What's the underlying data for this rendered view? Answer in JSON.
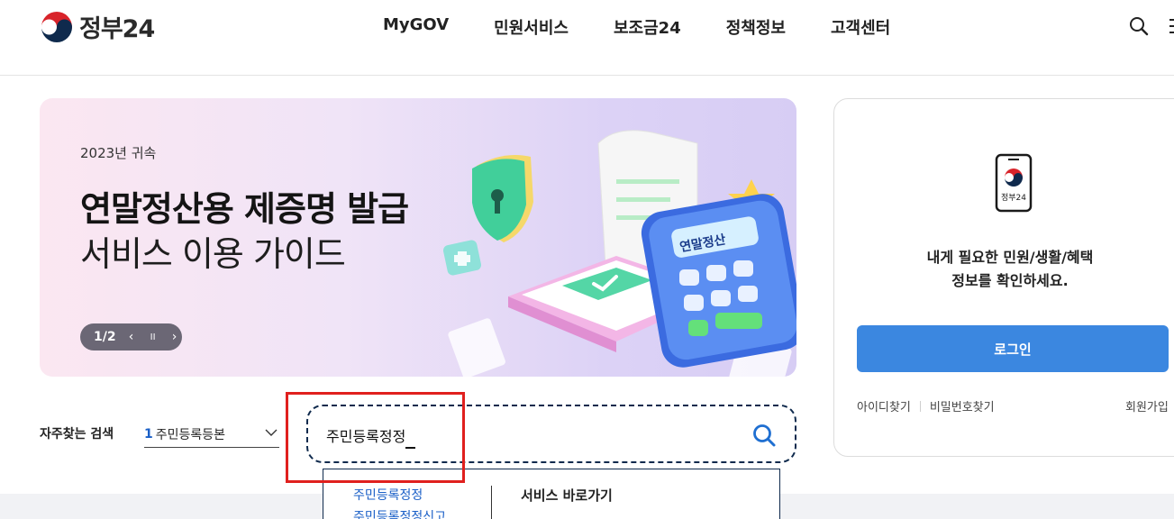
{
  "header": {
    "logo_text": "정부24",
    "nav": [
      "MyGOV",
      "민원서비스",
      "보조금24",
      "정책정보",
      "고객센터"
    ]
  },
  "banner": {
    "subtitle": "2023년 귀속",
    "title": "연말정산용 제증명 발급",
    "title2": "서비스 이용 가이드",
    "page": "1/2",
    "prev": "‹",
    "pause": "II",
    "next": "›",
    "calculator_label": "연말정산"
  },
  "login_card": {
    "icon_label": "정부24",
    "message_line1": "내게 필요한 민원/생활/혜택",
    "message_line2": "정보를 확인하세요.",
    "login_button": "로그인",
    "find_id": "아이디찾기",
    "find_password": "비밀번호찾기",
    "signup": "회원가입"
  },
  "frequent_search": {
    "label": "자주찾는 검색",
    "rank": "1",
    "value": "주민등록등본"
  },
  "search": {
    "value": "주민등록정정"
  },
  "suggestions": {
    "items": [
      "주민등록정정",
      "주민등록정정신고"
    ],
    "heading": "서비스 바로가기"
  },
  "colors": {
    "brand_blue": "#3b87e0",
    "link_blue": "#1a5fc7",
    "highlight_red": "#e0201e",
    "search_border": "#0f2a4d"
  }
}
